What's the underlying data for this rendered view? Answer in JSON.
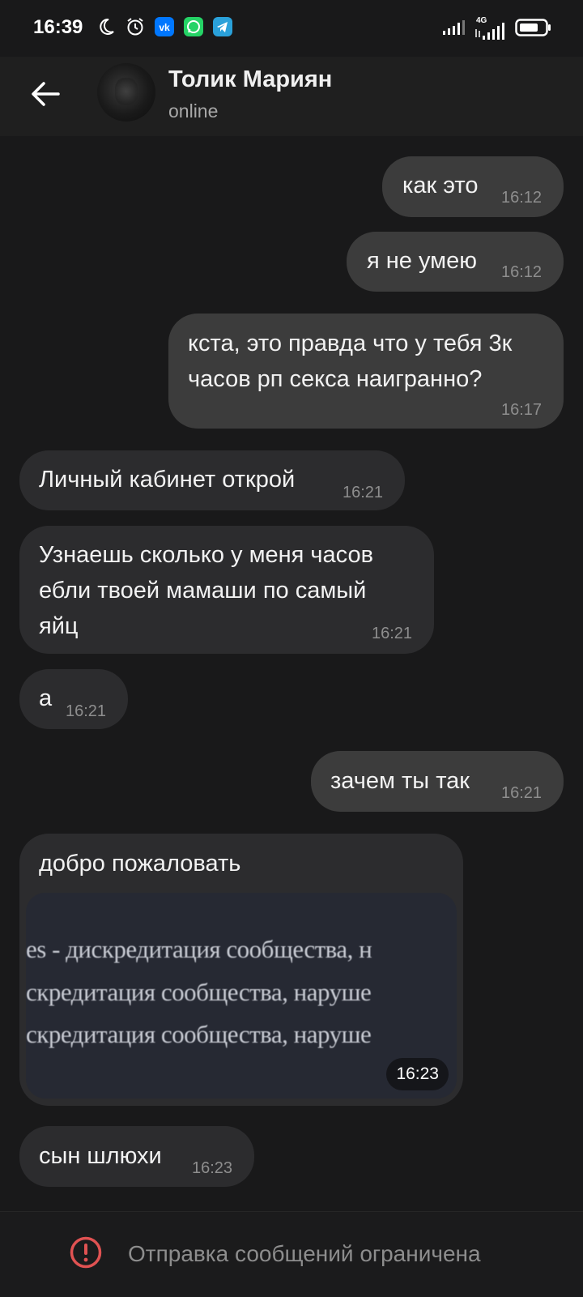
{
  "status_bar": {
    "time": "16:39",
    "icons": [
      "moon-icon",
      "alarm-icon",
      "vk-icon",
      "whatsapp-icon",
      "telegram-icon"
    ],
    "network": "4G",
    "accent_colors": {
      "vk": "#0077ff",
      "whatsapp": "#25d366",
      "telegram": "#2aa1da"
    }
  },
  "header": {
    "name": "Толик Мариян",
    "status": "online"
  },
  "messages": [
    {
      "direction": "out",
      "text": "как это",
      "time": "16:12"
    },
    {
      "direction": "out",
      "text": "я не умею",
      "time": "16:12"
    },
    {
      "direction": "out",
      "text": "кста, это правда что у тебя 3к\nчасов рп секса наигранно?",
      "time": "16:17"
    },
    {
      "direction": "in",
      "text": "Личный кабинет открой",
      "time": "16:21"
    },
    {
      "direction": "in",
      "text": "Узнаешь сколько у меня часов\nебли твоей мамаши по самый\nяйц",
      "time": "16:21"
    },
    {
      "direction": "in",
      "text": "а",
      "time": "16:21"
    },
    {
      "direction": "out",
      "text": "зачем ты так",
      "time": "16:21"
    },
    {
      "direction": "in",
      "text": "добро пожаловать",
      "time": "16:23",
      "photo_lines": [
        "es - дискредитация сообщества, н",
        "скредитация сообщества, наруше",
        "скредитация сообщества, наруше"
      ]
    },
    {
      "direction": "in",
      "text": "сын шлюхи",
      "time": "16:23"
    }
  ],
  "bottom_bar": {
    "text": "Отправка сообщений ограничена",
    "icon": "warning-circle-icon",
    "icon_color": "#e05252"
  }
}
